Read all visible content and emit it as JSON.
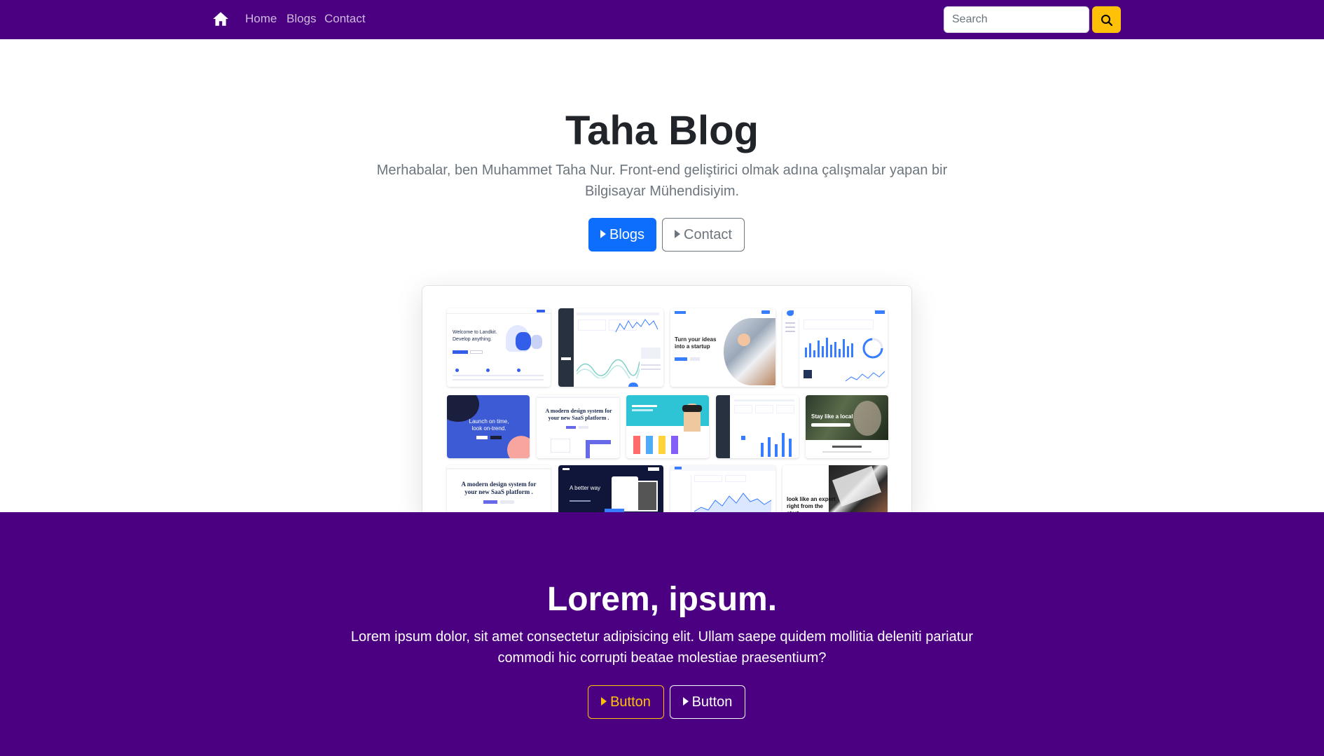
{
  "nav": {
    "links": [
      "Home",
      "Blogs",
      "Contact"
    ],
    "search_placeholder": "Search"
  },
  "hero": {
    "title": "Taha Blog",
    "text": "Merhabalar, ben Muhammet Taha Nur. Front-end geliştirici olmak adına çalışmalar yapan bir Bilgisayar Mühendisiyim.",
    "primary_button": "Blogs",
    "secondary_button": "Contact"
  },
  "preview": {
    "thumbs": [
      "Welcome to Landkit. Develop anything.",
      "Turn your ideas into a startup",
      "Launch on time, look on-trend.",
      "A modern design system for your new SaaS platform .",
      "Stay like a local",
      "A modern design system for your new SaaS platform .",
      "A better way",
      "look like an expert right from the start"
    ]
  },
  "band": {
    "title": "Lorem, ipsum.",
    "text": "Lorem ipsum dolor, sit amet consectetur adipisicing elit. Ullam saepe quidem mollitia deleniti pariatur commodi hic corrupti beatae molestiae praesentium?",
    "button1": "Button",
    "button2": "Button"
  },
  "colors": {
    "brand_purple": "#4b0082",
    "primary": "#0d6efd",
    "warning": "#ffc107"
  }
}
